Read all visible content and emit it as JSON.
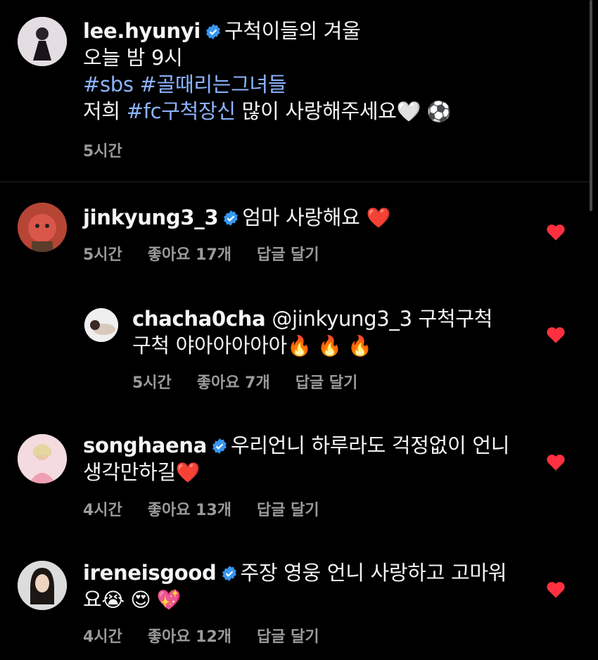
{
  "caption": {
    "username": "lee.hyunyi",
    "line1": "구척이들의 겨울",
    "line2": "오늘 밤 9시",
    "hashtags": "#sbs #골때리는그녀들",
    "line4_prefix": "저희 ",
    "line4_tag": "#fc구척장신",
    "line4_suffix": " 많이 사랑해주세요",
    "line4_emoji": "🤍 ⚽",
    "time": "5시간"
  },
  "comments": [
    {
      "username": "jinkyung3_3",
      "text": "엄마 사랑해요",
      "emoji": "❤️",
      "time": "5시간",
      "likes": "좋아요 17개",
      "reply_label": "답글 달기"
    },
    {
      "username": "chacha0cha",
      "mention": "@jinkyung3_3",
      "text1": "구척구척",
      "text2": "구척 야아아아아아",
      "emoji": "🔥 🔥 🔥",
      "time": "5시간",
      "likes": "좋아요 7개",
      "reply_label": "답글 달기"
    },
    {
      "username": "songhaena",
      "text1": "우리언니 하루라도 걱정없이 언니",
      "text2": "생각만하길",
      "emoji": "❤️",
      "time": "4시간",
      "likes": "좋아요 13개",
      "reply_label": "답글 달기"
    },
    {
      "username": "ireneisgood",
      "text1": "주장 영웅 언니 사랑하고 고마워",
      "text2": "요",
      "emoji": "😭 😍 💖",
      "time": "4시간",
      "likes": "좋아요 12개",
      "reply_label": "답글 달기"
    }
  ],
  "colors": {
    "heart": "#ff3040",
    "verified": "#3897f0",
    "hashtag": "#8cb4ff"
  }
}
